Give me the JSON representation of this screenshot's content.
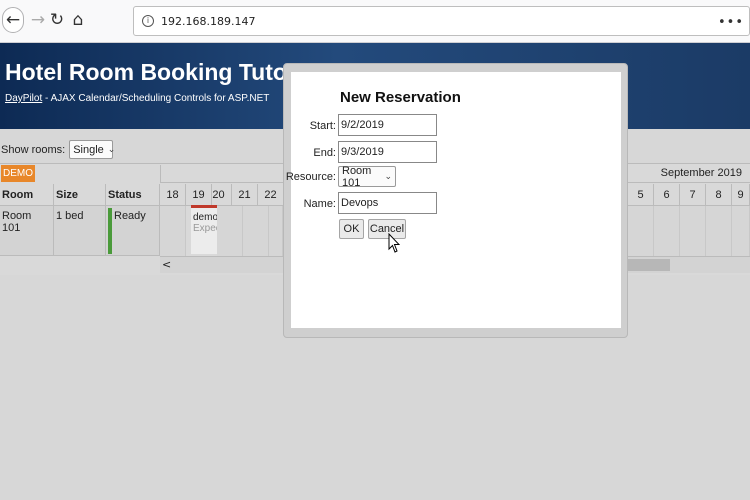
{
  "browser": {
    "url": "192.168.189.147",
    "icons": {
      "back": "back-arrow-icon",
      "forward": "forward-arrow-icon",
      "reload": "reload-icon",
      "home": "home-icon",
      "info": "info-icon",
      "more": "more-icon"
    }
  },
  "header": {
    "title": "Hotel Room Booking Tutorial",
    "link": "DayPilot",
    "subtitle_rest": " - AJAX Calendar/Scheduling Controls for ASP.NET"
  },
  "toolbar": {
    "show_rooms_label": "Show rooms:",
    "show_rooms_value": "Single"
  },
  "scheduler": {
    "demo_badge": "DEMO",
    "columns": [
      "Room",
      "Size",
      "Status"
    ],
    "month": "September 2019",
    "days_left": [
      "18",
      "19",
      "20",
      "21",
      "22"
    ],
    "days_right": [
      "5",
      "6",
      "7",
      "8",
      "9"
    ],
    "rows": [
      {
        "room": "Room 101",
        "size": "1 bed",
        "status": "Ready"
      }
    ],
    "event": {
      "title": "demo",
      "subtitle": "Expec"
    },
    "scroll_left": "<"
  },
  "dialog": {
    "title": "New Reservation",
    "start_label": "Start:",
    "start_value": "9/2/2019",
    "end_label": "End:",
    "end_value": "9/3/2019",
    "resource_label": "Resource:",
    "resource_value": "Room 101",
    "name_label": "Name:",
    "name_value": "Devops",
    "ok_label": "OK",
    "cancel_label": "Cancel"
  },
  "colors": {
    "header_bg": "#1b3b66",
    "demo_badge": "#e8872a",
    "event_bar": "#c0392b",
    "status_ready": "#4a9a3a"
  }
}
